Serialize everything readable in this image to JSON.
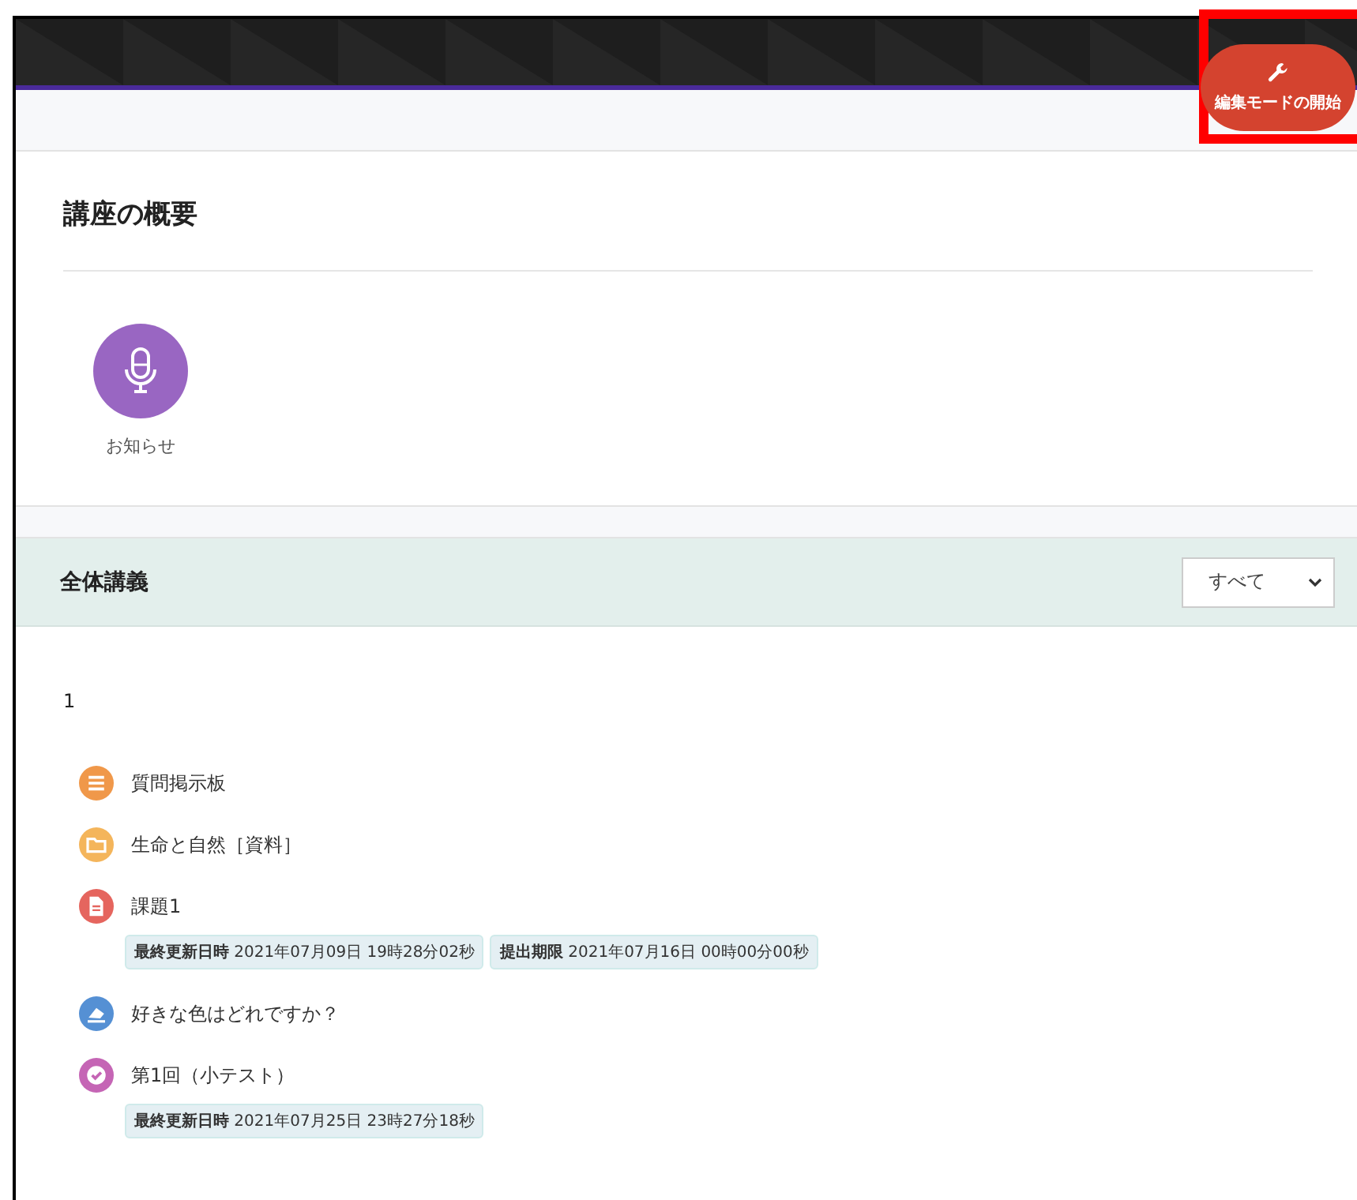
{
  "header": {
    "edit_button": {
      "label": "編集モードの開始",
      "highlighted": true
    }
  },
  "overview": {
    "title": "講座の概要",
    "announcement": {
      "label": "お知らせ"
    }
  },
  "section": {
    "title": "全体講義",
    "filter": {
      "value": "すべて"
    },
    "number": "1",
    "activities": [
      {
        "kind": "forum",
        "color": "#f0984a",
        "name": "質問掲示板"
      },
      {
        "kind": "folder",
        "color": "#f4b55b",
        "name": "生命と自然［資料］"
      },
      {
        "kind": "assign",
        "color": "#e5655e",
        "name": "課題1",
        "badges": [
          "**最終更新日時** 2021年07月09日 19時28分02秒",
          "**提出期限** 2021年07月16日 00時00分00秒"
        ]
      },
      {
        "kind": "choice",
        "color": "#5590d4",
        "name": "好きな色はどれですか？"
      },
      {
        "kind": "quiz",
        "color": "#c565b5",
        "name": "第1回（小テスト）",
        "badges": [
          "**最終更新日時** 2021年07月25日 23時27分18秒"
        ]
      }
    ]
  }
}
